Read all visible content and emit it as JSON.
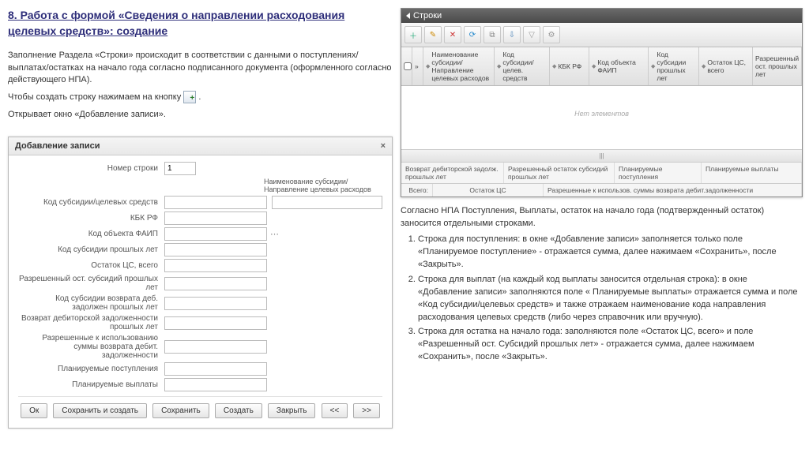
{
  "heading": "8. Работа с формой «Сведения о направлении расходования целевых средств»: создание",
  "para1": "Заполнение Раздела «Строки» происходит в соответствии с данными о поступлениях/выплатах/остатках на начало года согласно подписанного документа (оформленного согласно действующего НПА).",
  "para2a": "Чтобы создать строку нажимаем на кнопку ",
  "para2b": " .",
  "para3": "Открывает окно «Добавление записи».",
  "dialog": {
    "title": "Добавление записи",
    "close": "×",
    "fields": {
      "f1": "Номер строки",
      "v1": "1",
      "extra1": "Наименование субсидии/Направление целевых расходов",
      "f2": "Код субсидии/целевых средств",
      "f3": "КБК РФ",
      "f4": "Код объекта ФАИП",
      "f5": "Код субсидии прошлых лет",
      "f6": "Остаток ЦС, всего",
      "f7": "Разрешенный ост. субсидий прошлых лет",
      "f8": "Код субсидии возврата деб. задолжен прошлых лет",
      "f9": "Возврат дебиторской задолженности прошлых лет",
      "f10": "Разрешенные к использованию суммы возврата дебит. задолженности",
      "f11": "Планируемые поступления",
      "f12": "Планируемые выплаты"
    },
    "buttons": {
      "ok": "Ок",
      "saveCreate": "Сохранить и создать",
      "save": "Сохранить",
      "create": "Создать",
      "close": "Закрыть",
      "prev": "<<",
      "next": ">>"
    }
  },
  "panel": {
    "title": "Строки",
    "cols": {
      "c1": "Наименование субсидии/Направление целевых расходов",
      "c2": "Код субсидии/целев. средств",
      "c3": "КБК РФ",
      "c4": "Код объекта ФАИП",
      "c5": "Код субсидии прошлых лет",
      "c6": "Остаток ЦС, всего",
      "c7": "Разрешенный ост. прошлых лет"
    },
    "empty": "Нет элементов",
    "footer": {
      "total": "Всего:",
      "f1": "Возврат дебиторской задолж. прошлых лет",
      "f2": "Разрешенный остаток субсидий прошлых лет",
      "f3": "Планируемые поступления",
      "f4": "Планируемые выплаты",
      "f5": "Остаток ЦС",
      "f6": "Разрешенные к использов. суммы возврата дебит.задолженности"
    }
  },
  "instr": {
    "intro": "Согласно НПА Поступления, Выплаты, остаток на начало года (подтвержденный остаток) заносится отдельными строками.",
    "li1": "Строка для поступления: в окне «Добавление записи» заполняется только поле «Планируемое поступление» - отражается сумма, далее нажимаем «Сохранить», после «Закрыть».",
    "li2": "Строка для выплат (на каждый код выплаты заносится отдельная строка): в окне «Добавление записи» заполняются поле « Планируемые выплаты» отражается сумма и поле «Код субсидии/целевых средств» и также отражаем наименование кода направления расходования целевых средств (либо через справочник или вручную).",
    "li3": "Строка для остатка на начало года: заполняются поле «Остаток ЦС, всего» и поле «Разрешенный ост. Субсидий прошлых лет» - отражается сумма, далее нажимаем «Сохранить», после «Закрыть»."
  }
}
